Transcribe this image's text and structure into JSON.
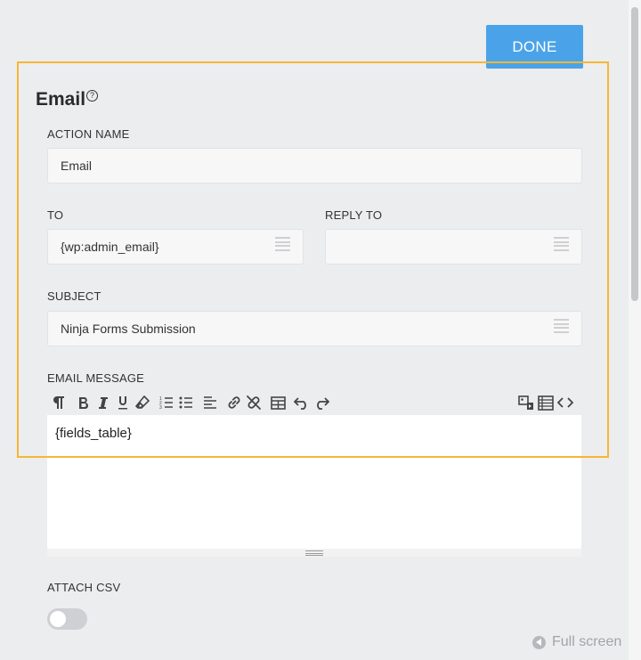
{
  "header": {
    "done_label": "DONE"
  },
  "section": {
    "title": "Email",
    "help_icon": "?"
  },
  "fields": {
    "action_name": {
      "label": "ACTION NAME",
      "value": "Email"
    },
    "to": {
      "label": "TO",
      "value": "{wp:admin_email}"
    },
    "reply_to": {
      "label": "REPLY TO",
      "value": ""
    },
    "subject": {
      "label": "SUBJECT",
      "value": "Ninja Forms Submission"
    },
    "email_message": {
      "label": "EMAIL MESSAGE",
      "content": "{fields_table}",
      "toolbar": [
        "paragraph-icon",
        "bold-icon",
        "italic-icon",
        "underline-icon",
        "eraser-icon",
        "ordered-list-icon",
        "unordered-list-icon",
        "align-left-icon",
        "link-icon",
        "unlink-icon",
        "table-icon",
        "undo-icon",
        "redo-icon",
        "media-icon",
        "merge-tags-icon",
        "code-view-icon"
      ]
    },
    "attach_csv": {
      "label": "ATTACH CSV",
      "enabled": false
    }
  },
  "footer": {
    "fullscreen_label": "Full screen"
  },
  "colors": {
    "accent": "#4aa3e8",
    "highlight": "#f6b733"
  }
}
